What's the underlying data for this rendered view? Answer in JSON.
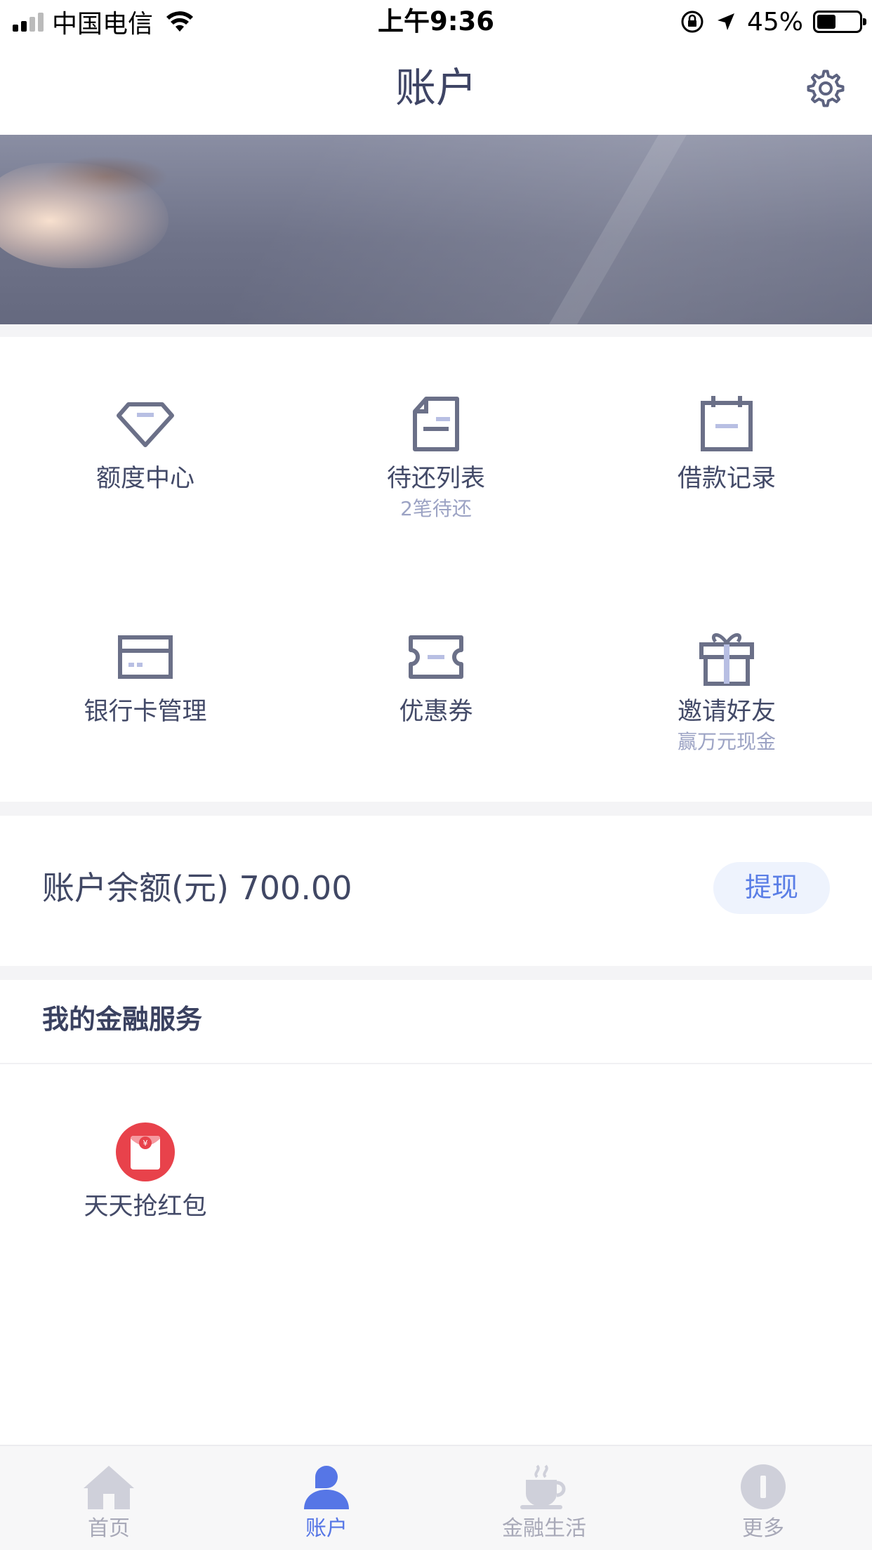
{
  "status_bar": {
    "carrier": "中国电信",
    "time": "上午9:36",
    "battery": "45%",
    "battery_level": 0.45
  },
  "nav": {
    "title": "账户",
    "settings_icon": "gear-icon"
  },
  "grid": {
    "items": [
      {
        "label": "额度中心",
        "sub": "",
        "icon": "diamond-icon"
      },
      {
        "label": "待还列表",
        "sub": "2笔待还",
        "icon": "document-icon"
      },
      {
        "label": "借款记录",
        "sub": "",
        "icon": "calendar-icon"
      },
      {
        "label": "银行卡管理",
        "sub": "",
        "icon": "bank-card-icon"
      },
      {
        "label": "优惠券",
        "sub": "",
        "icon": "coupon-icon"
      },
      {
        "label": "邀请好友",
        "sub": "赢万元现金",
        "icon": "gift-icon"
      }
    ]
  },
  "balance": {
    "label": "账户余额(元) 700.00",
    "withdraw_label": "提现"
  },
  "services": {
    "title": "我的金融服务",
    "items": [
      {
        "label": "天天抢红包",
        "icon": "red-envelope-icon"
      }
    ]
  },
  "tab_bar": {
    "tabs": [
      {
        "label": "首页",
        "icon": "home-icon",
        "active": false
      },
      {
        "label": "账户",
        "icon": "user-icon",
        "active": true
      },
      {
        "label": "金融生活",
        "icon": "coffee-cup-icon",
        "active": false
      },
      {
        "label": "更多",
        "icon": "more-icon",
        "active": false
      }
    ]
  },
  "colors": {
    "accent": "#5676e6",
    "icon_gray": "#6b7088",
    "icon_highlight": "#b8bfe3",
    "red": "#e8424b"
  }
}
